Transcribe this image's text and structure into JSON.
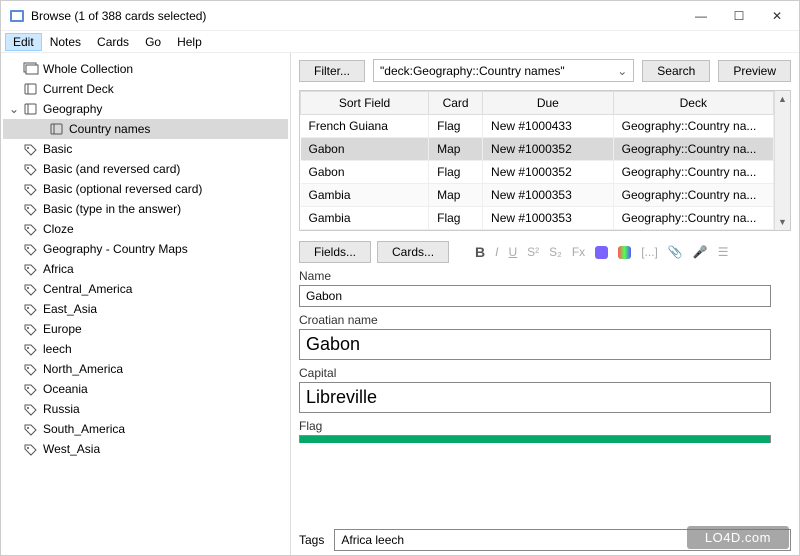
{
  "window": {
    "title": "Browse (1 of 388 cards selected)",
    "min_label": "—",
    "max_label": "☐",
    "close_label": "✕"
  },
  "menu": {
    "edit": "Edit",
    "notes": "Notes",
    "cards": "Cards",
    "go": "Go",
    "help": "Help"
  },
  "sidebar": {
    "items": [
      {
        "label": "Whole Collection",
        "indent": 0,
        "icon": "stack",
        "chev": ""
      },
      {
        "label": "Current Deck",
        "indent": 0,
        "icon": "deck",
        "chev": ""
      },
      {
        "label": "Geography",
        "indent": 0,
        "icon": "deck",
        "chev": "⌄"
      },
      {
        "label": "Country names",
        "indent": 2,
        "icon": "deck",
        "chev": "",
        "selected": true
      },
      {
        "label": "Basic",
        "indent": 0,
        "icon": "tag",
        "chev": ""
      },
      {
        "label": "Basic (and reversed card)",
        "indent": 0,
        "icon": "tag",
        "chev": ""
      },
      {
        "label": "Basic (optional reversed card)",
        "indent": 0,
        "icon": "tag",
        "chev": ""
      },
      {
        "label": "Basic (type in the answer)",
        "indent": 0,
        "icon": "tag",
        "chev": ""
      },
      {
        "label": "Cloze",
        "indent": 0,
        "icon": "tag",
        "chev": ""
      },
      {
        "label": "Geography - Country Maps",
        "indent": 0,
        "icon": "tag",
        "chev": ""
      },
      {
        "label": "Africa",
        "indent": 0,
        "icon": "tag",
        "chev": ""
      },
      {
        "label": "Central_America",
        "indent": 0,
        "icon": "tag",
        "chev": ""
      },
      {
        "label": "East_Asia",
        "indent": 0,
        "icon": "tag",
        "chev": ""
      },
      {
        "label": "Europe",
        "indent": 0,
        "icon": "tag",
        "chev": ""
      },
      {
        "label": "leech",
        "indent": 0,
        "icon": "tag",
        "chev": ""
      },
      {
        "label": "North_America",
        "indent": 0,
        "icon": "tag",
        "chev": ""
      },
      {
        "label": "Oceania",
        "indent": 0,
        "icon": "tag",
        "chev": ""
      },
      {
        "label": "Russia",
        "indent": 0,
        "icon": "tag",
        "chev": ""
      },
      {
        "label": "South_America",
        "indent": 0,
        "icon": "tag",
        "chev": ""
      },
      {
        "label": "West_Asia",
        "indent": 0,
        "icon": "tag",
        "chev": ""
      }
    ]
  },
  "toolbar": {
    "filter": "Filter...",
    "search_value": "\"deck:Geography::Country names\"",
    "search": "Search",
    "preview": "Preview"
  },
  "table": {
    "headers": [
      "Sort Field",
      "Card",
      "Due",
      "Deck"
    ],
    "rows": [
      {
        "c": [
          "French Guiana",
          "Flag",
          "New #1000433",
          "Geography::Country na..."
        ],
        "selected": false
      },
      {
        "c": [
          "Gabon",
          "Map",
          "New #1000352",
          "Geography::Country na..."
        ],
        "selected": true
      },
      {
        "c": [
          "Gabon",
          "Flag",
          "New #1000352",
          "Geography::Country na..."
        ],
        "selected": false
      },
      {
        "c": [
          "Gambia",
          "Map",
          "New #1000353",
          "Geography::Country na..."
        ],
        "selected": false
      },
      {
        "c": [
          "Gambia",
          "Flag",
          "New #1000353",
          "Geography::Country na..."
        ],
        "selected": false
      }
    ]
  },
  "editor_buttons": {
    "fields": "Fields...",
    "cards": "Cards..."
  },
  "editor_icons": {
    "bold": "B",
    "italic": "I",
    "underline": "U",
    "sup": "S²",
    "sub": "S₂",
    "fx": "Fx",
    "brackets": "[...]",
    "clip": "📎",
    "mic": "🎤",
    "more": "☰"
  },
  "fields": {
    "name_label": "Name",
    "name_value": "Gabon",
    "croatian_label": "Croatian name",
    "croatian_value": "Gabon",
    "capital_label": "Capital",
    "capital_value": "Libreville",
    "flag_label": "Flag"
  },
  "tags": {
    "label": "Tags",
    "value": "Africa leech"
  },
  "watermark": "LO4D.com"
}
